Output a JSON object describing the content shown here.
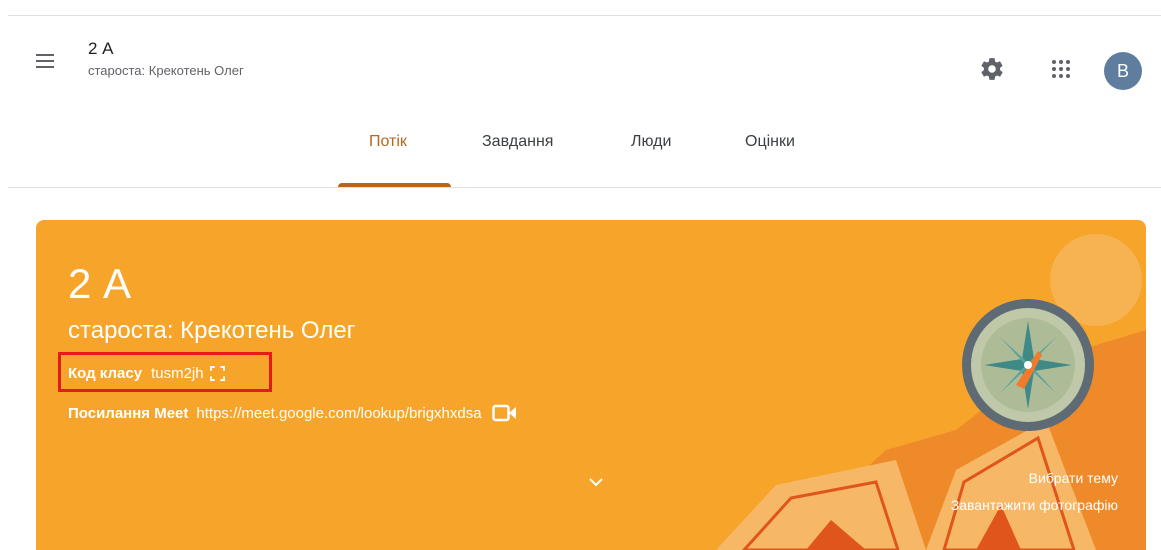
{
  "header": {
    "class_name": "2 А",
    "subtitle": "староста: Крекотень Олег",
    "avatar_letter": "В",
    "icons": [
      "menu-icon",
      "gear-icon",
      "apps-grid-icon"
    ]
  },
  "tabs": [
    {
      "label": "Потік",
      "active": true
    },
    {
      "label": "Завдання",
      "active": false
    },
    {
      "label": "Люди",
      "active": false
    },
    {
      "label": "Оцінки",
      "active": false
    }
  ],
  "banner": {
    "title": "2 А",
    "subtitle": "староста: Крекотень Олег",
    "class_code_label": "Код класу",
    "class_code": "tusm2jh",
    "meet_label": "Посилання Meet",
    "meet_link": "https://meet.google.com/lookup/brigxhxdsa",
    "choose_theme": "Вибрати тему",
    "upload_photo": "Завантажити фотографію",
    "icons": [
      "fullscreen-icon",
      "video-camera-icon",
      "chevron-down-icon"
    ]
  },
  "colors": {
    "accent": "#b8661c",
    "banner": "#f7a52a",
    "highlight_box": "#e31b1b",
    "avatar": "#5f7e9f"
  }
}
